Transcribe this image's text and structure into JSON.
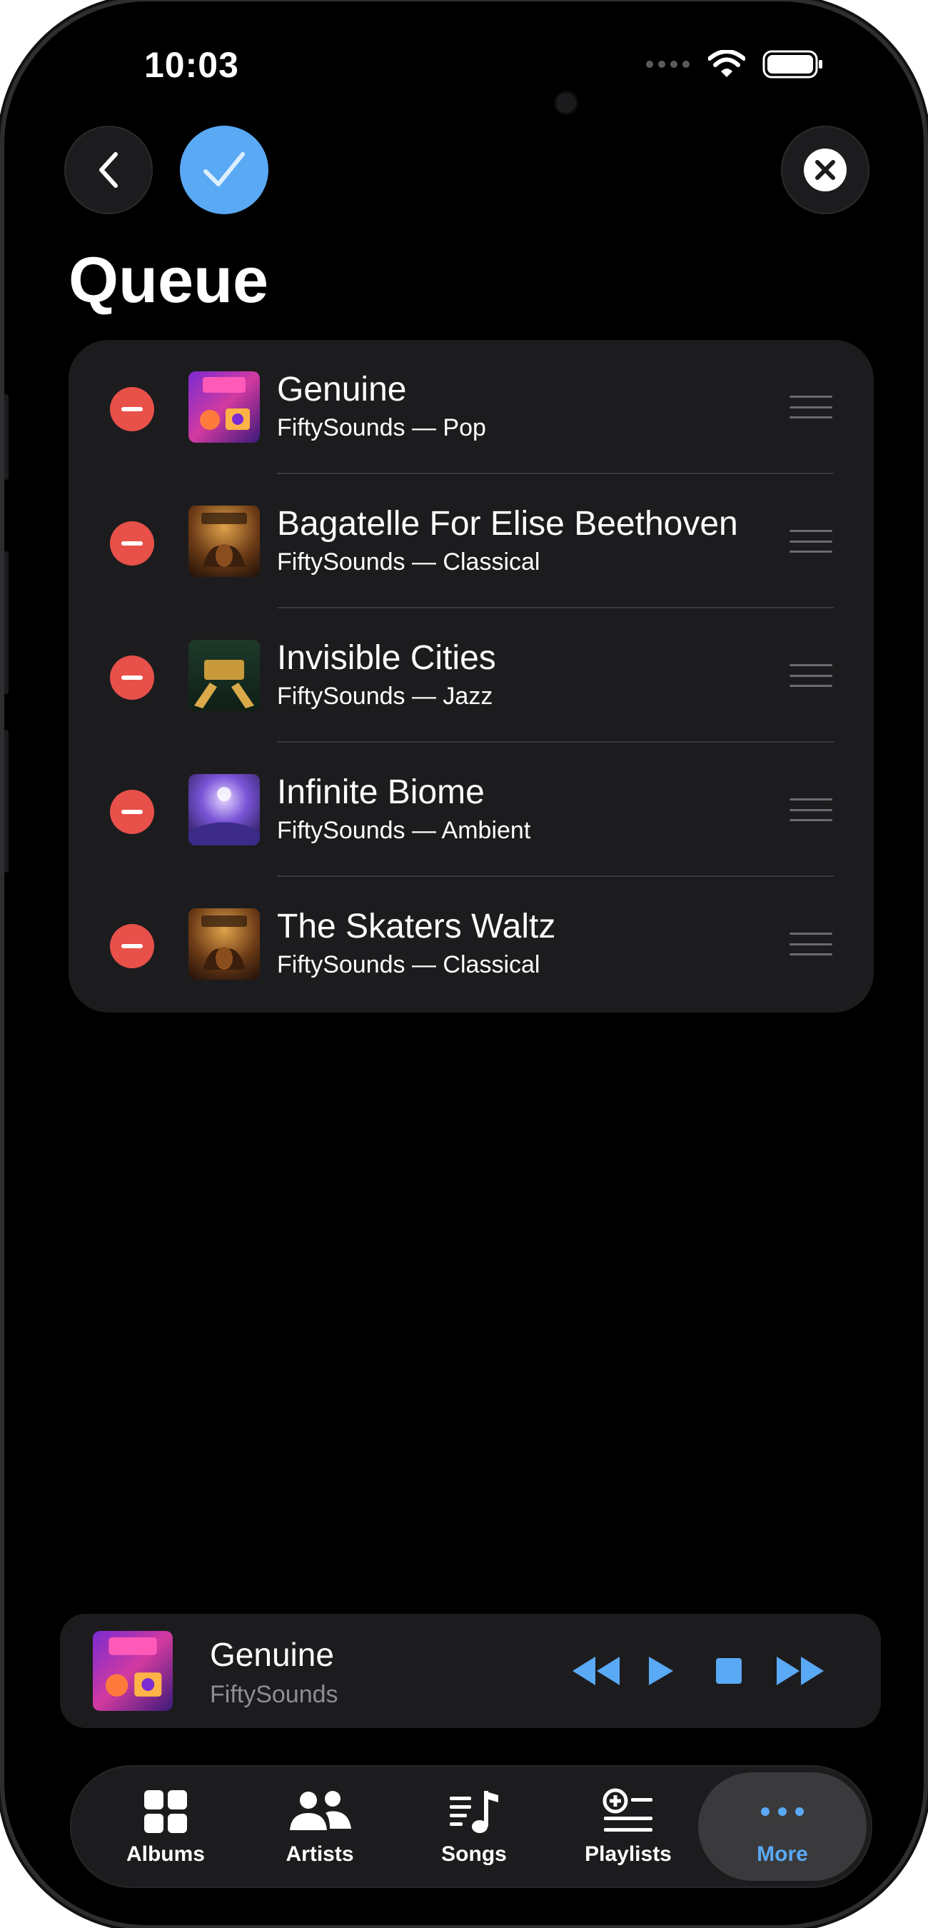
{
  "status_bar": {
    "time": "10:03"
  },
  "nav": {
    "back_icon": "chevron-left-icon",
    "done_icon": "checkmark-icon",
    "close_icon": "xmark-circle-icon",
    "accent_color": "#5aa9f5"
  },
  "page": {
    "title": "Queue"
  },
  "queue": [
    {
      "title": "Genuine",
      "subtitle": "FiftySounds — Pop",
      "artwork": "pop-essentials-art"
    },
    {
      "title": "Bagatelle For Elise Beethoven",
      "subtitle": "FiftySounds — Classical",
      "artwork": "classical-essentials-art"
    },
    {
      "title": "Invisible Cities",
      "subtitle": "FiftySounds — Jazz",
      "artwork": "jazz-art"
    },
    {
      "title": "Infinite Biome",
      "subtitle": "FiftySounds — Ambient",
      "artwork": "ambient-art"
    },
    {
      "title": "The Skaters Waltz",
      "subtitle": "FiftySounds — Classical",
      "artwork": "classical-essentials-art"
    }
  ],
  "now_playing": {
    "title": "Genuine",
    "artist": "FiftySounds",
    "artwork": "pop-essentials-art"
  },
  "tabs": [
    {
      "label": "Albums",
      "icon": "grid-icon",
      "active": false
    },
    {
      "label": "Artists",
      "icon": "people-icon",
      "active": false
    },
    {
      "label": "Songs",
      "icon": "music-note-list-icon",
      "active": false
    },
    {
      "label": "Playlists",
      "icon": "playlist-add-icon",
      "active": false
    },
    {
      "label": "More",
      "icon": "ellipsis-icon",
      "active": true
    }
  ]
}
